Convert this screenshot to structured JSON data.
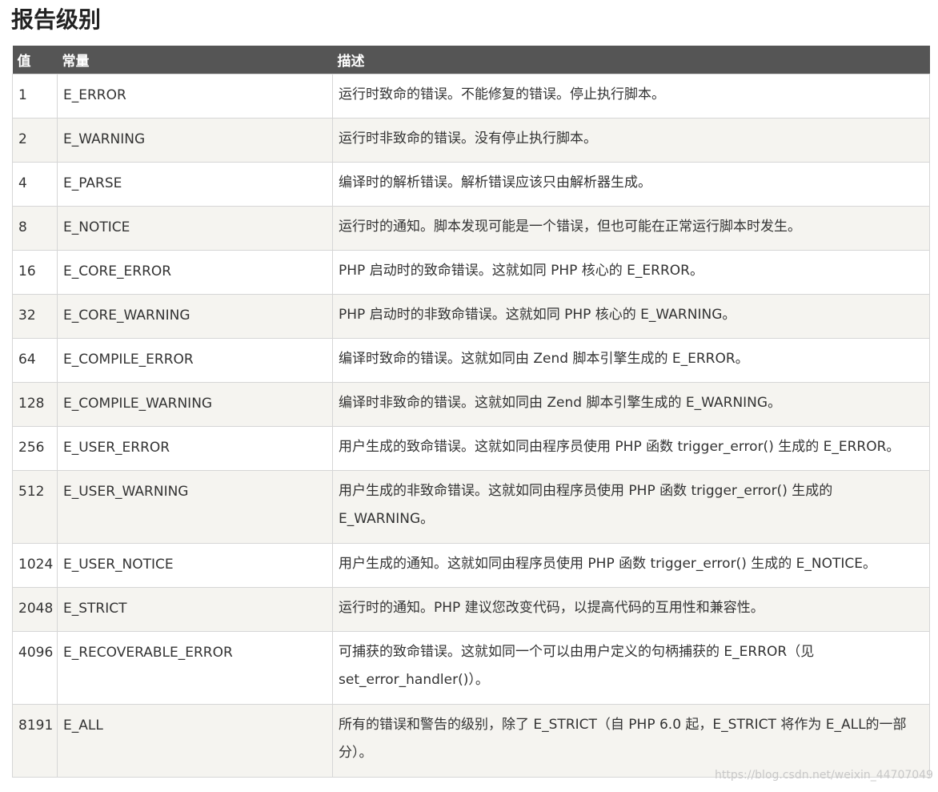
{
  "title": "报告级别",
  "table": {
    "headers": [
      "值",
      "常量",
      "描述"
    ],
    "rows": [
      {
        "value": "1",
        "constant": "E_ERROR",
        "description": "运行时致命的错误。不能修复的错误。停止执行脚本。"
      },
      {
        "value": "2",
        "constant": "E_WARNING",
        "description": "运行时非致命的错误。没有停止执行脚本。"
      },
      {
        "value": "4",
        "constant": "E_PARSE",
        "description": "编译时的解析错误。解析错误应该只由解析器生成。"
      },
      {
        "value": "8",
        "constant": "E_NOTICE",
        "description": "运行时的通知。脚本发现可能是一个错误，但也可能在正常运行脚本时发生。"
      },
      {
        "value": "16",
        "constant": "E_CORE_ERROR",
        "description": "PHP 启动时的致命错误。这就如同 PHP 核心的 E_ERROR。"
      },
      {
        "value": "32",
        "constant": "E_CORE_WARNING",
        "description": "PHP 启动时的非致命错误。这就如同 PHP 核心的 E_WARNING。"
      },
      {
        "value": "64",
        "constant": "E_COMPILE_ERROR",
        "description": "编译时致命的错误。这就如同由 Zend 脚本引擎生成的 E_ERROR。"
      },
      {
        "value": "128",
        "constant": "E_COMPILE_WARNING",
        "description": "编译时非致命的错误。这就如同由 Zend 脚本引擎生成的 E_WARNING。"
      },
      {
        "value": "256",
        "constant": "E_USER_ERROR",
        "description": "用户生成的致命错误。这就如同由程序员使用 PHP 函数 trigger_error() 生成的 E_ERROR。"
      },
      {
        "value": "512",
        "constant": "E_USER_WARNING",
        "description": "用户生成的非致命错误。这就如同由程序员使用 PHP 函数 trigger_error() 生成的 E_WARNING。"
      },
      {
        "value": "1024",
        "constant": "E_USER_NOTICE",
        "description": "用户生成的通知。这就如同由程序员使用 PHP 函数 trigger_error() 生成的 E_NOTICE。"
      },
      {
        "value": "2048",
        "constant": "E_STRICT",
        "description": "运行时的通知。PHP 建议您改变代码，以提高代码的互用性和兼容性。"
      },
      {
        "value": "4096",
        "constant": "E_RECOVERABLE_ERROR",
        "description": "可捕获的致命错误。这就如同一个可以由用户定义的句柄捕获的 E_ERROR（见 set_error_handler()）。"
      },
      {
        "value": "8191",
        "constant": "E_ALL",
        "description": "所有的错误和警告的级别，除了 E_STRICT（自 PHP 6.0 起，E_STRICT 将作为 E_ALL的一部分）。"
      }
    ]
  },
  "watermark": "https://blog.csdn.net/weixin_44707049"
}
